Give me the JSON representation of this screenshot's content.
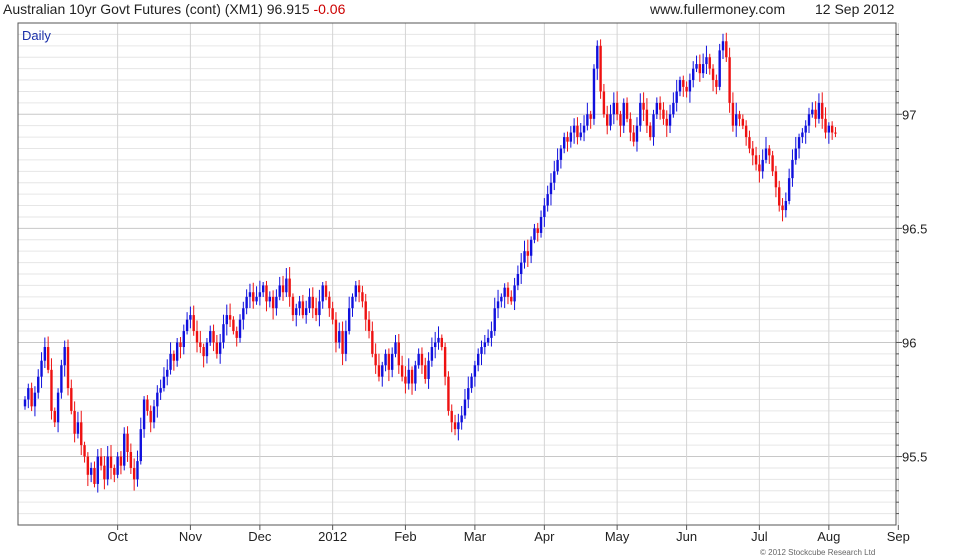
{
  "header": {
    "title": "Australian 10yr Govt Futures (cont) (XM1) 96.915",
    "change": "-0.06",
    "site": "www.fullermoney.com",
    "date": "12 Sep 2012"
  },
  "footer": {
    "copyright": "© 2012 Stockcube Research Ltd"
  },
  "colors": {
    "up": "#1010dd",
    "down": "#ee1111",
    "grid": "#d4d4d4",
    "frame": "#555555"
  },
  "chart_data": {
    "type": "candlestick",
    "period_label": "Daily",
    "title": "",
    "xlabel": "",
    "ylabel": "",
    "ylim": [
      95.2,
      97.4
    ],
    "y_ticks": [
      95.5,
      96,
      96.5,
      97
    ],
    "y_tick_labels": [
      "95.5",
      "96",
      "96.5",
      "97"
    ],
    "x_tick_labels": [
      "Oct",
      "Nov",
      "Dec",
      "2012",
      "Feb",
      "Mar",
      "Apr",
      "May",
      "Jun",
      "Jul",
      "Aug",
      "Sep"
    ],
    "x_tick_index": [
      28,
      50,
      71,
      93,
      115,
      136,
      157,
      179,
      200,
      222,
      243,
      264
    ],
    "grid": true,
    "y_axis_side": "right",
    "close": [
      95.75,
      95.8,
      95.72,
      95.78,
      95.85,
      95.92,
      95.98,
      95.88,
      95.7,
      95.65,
      95.78,
      95.9,
      95.98,
      95.8,
      95.7,
      95.6,
      95.65,
      95.55,
      95.5,
      95.42,
      95.45,
      95.38,
      95.5,
      95.46,
      95.4,
      95.5,
      95.45,
      95.42,
      95.5,
      95.46,
      95.6,
      95.52,
      95.45,
      95.4,
      95.48,
      95.62,
      95.75,
      95.7,
      95.65,
      95.72,
      95.78,
      95.8,
      95.85,
      95.88,
      95.95,
      95.92,
      96.0,
      95.98,
      96.05,
      96.1,
      96.12,
      96.05,
      96.0,
      95.98,
      95.94,
      96.0,
      96.05,
      96.0,
      95.95,
      96.0,
      96.08,
      96.12,
      96.1,
      96.05,
      96.02,
      96.1,
      96.15,
      96.2,
      96.22,
      96.18,
      96.2,
      96.22,
      96.25,
      96.18,
      96.2,
      96.15,
      96.2,
      96.25,
      96.22,
      96.28,
      96.2,
      96.12,
      96.15,
      96.18,
      96.12,
      96.15,
      96.2,
      96.15,
      96.12,
      96.18,
      96.25,
      96.2,
      96.15,
      96.1,
      96.0,
      96.05,
      95.95,
      96.05,
      96.15,
      96.2,
      96.25,
      96.22,
      96.18,
      96.1,
      96.05,
      95.95,
      95.9,
      95.85,
      95.9,
      95.95,
      95.88,
      95.95,
      96.0,
      95.9,
      95.85,
      95.82,
      95.88,
      95.82,
      95.9,
      95.95,
      95.9,
      95.84,
      95.92,
      95.98,
      96.0,
      96.02,
      95.98,
      95.85,
      95.7,
      95.65,
      95.62,
      95.65,
      95.68,
      95.75,
      95.8,
      95.85,
      95.9,
      95.95,
      95.98,
      96.0,
      96.02,
      96.05,
      96.15,
      96.18,
      96.2,
      96.24,
      96.2,
      96.18,
      96.25,
      96.3,
      96.35,
      96.4,
      96.38,
      96.45,
      96.5,
      96.48,
      96.55,
      96.6,
      96.65,
      96.7,
      96.75,
      96.8,
      96.85,
      96.9,
      96.88,
      96.92,
      96.95,
      96.9,
      96.92,
      96.95,
      97.0,
      96.98,
      97.2,
      97.3,
      97.1,
      97.0,
      96.95,
      97.0,
      97.05,
      97.0,
      96.95,
      97.05,
      96.98,
      96.92,
      96.88,
      96.95,
      97.05,
      97.02,
      96.95,
      96.9,
      97.0,
      97.05,
      97.02,
      96.98,
      96.95,
      97.0,
      97.05,
      97.1,
      97.15,
      97.12,
      97.1,
      97.15,
      97.2,
      97.22,
      97.18,
      97.22,
      97.25,
      97.2,
      97.15,
      97.12,
      97.28,
      97.32,
      97.25,
      97.05,
      96.95,
      97.0,
      96.98,
      96.95,
      96.9,
      96.85,
      96.82,
      96.78,
      96.75,
      96.8,
      96.85,
      96.82,
      96.75,
      96.68,
      96.6,
      96.58,
      96.62,
      96.72,
      96.8,
      96.85,
      96.9,
      96.92,
      96.95,
      97.0,
      97.02,
      96.98,
      97.05,
      96.98,
      96.92,
      96.95,
      96.92,
      96.915
    ]
  }
}
